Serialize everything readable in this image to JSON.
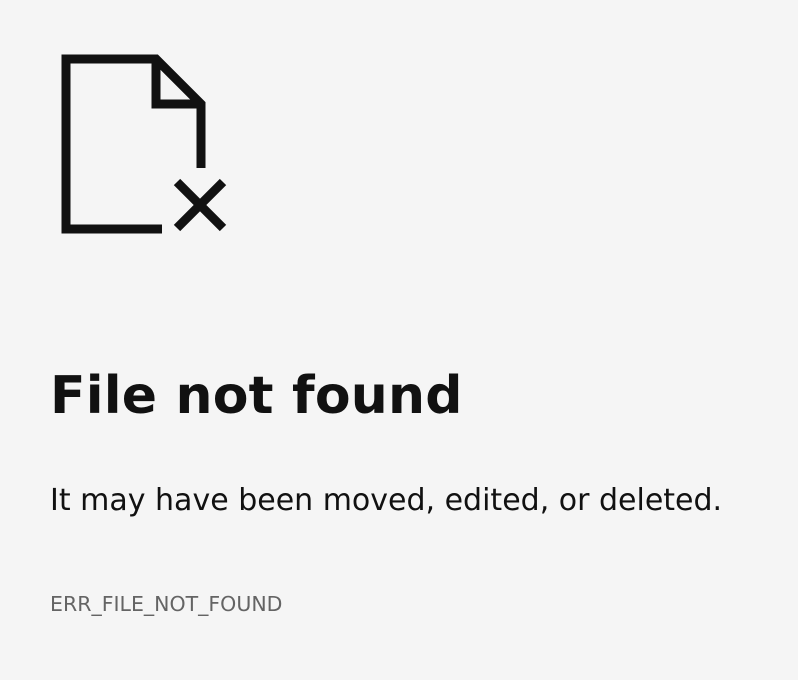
{
  "error": {
    "icon": "file-not-found-icon",
    "title": "File not found",
    "message": "It may have been moved, edited, or deleted.",
    "code": "ERR_FILE_NOT_FOUND"
  },
  "colors": {
    "background": "#f5f5f5",
    "text": "#111111",
    "code_text": "#646464"
  }
}
